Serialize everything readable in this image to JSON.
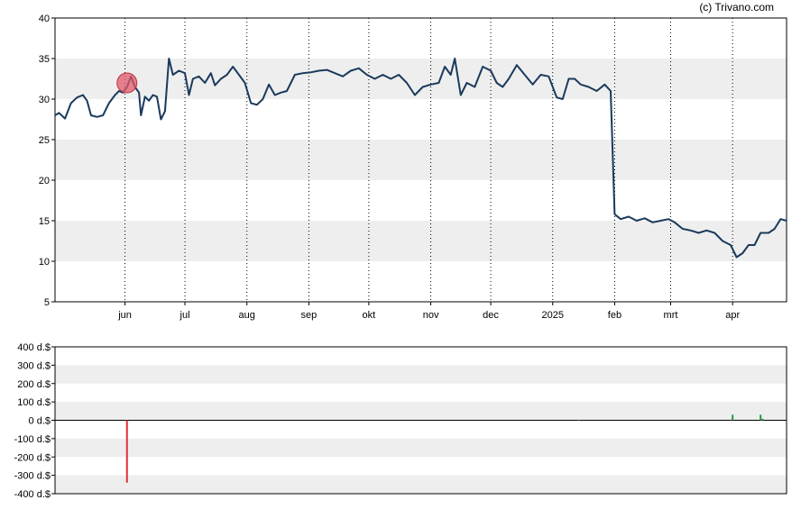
{
  "credit": "(c) Trivano.com",
  "chart_data": [
    {
      "type": "line",
      "title": "",
      "xlabel": "",
      "ylabel": "",
      "ylim": [
        5,
        40
      ],
      "y_ticks": [
        5,
        10,
        15,
        20,
        25,
        30,
        35,
        40
      ],
      "banding": "alternating light gray horizontal bands",
      "grid": "dotted vertical lines at month starts",
      "months": [
        {
          "label": "jun",
          "date": "2024-06-01"
        },
        {
          "label": "jul",
          "date": "2024-07-01"
        },
        {
          "label": "aug",
          "date": "2024-08-01"
        },
        {
          "label": "sep",
          "date": "2024-09-01"
        },
        {
          "label": "okt",
          "date": "2024-10-01"
        },
        {
          "label": "nov",
          "date": "2024-11-01"
        },
        {
          "label": "dec",
          "date": "2024-12-01"
        },
        {
          "label": "2025",
          "date": "2025-01-01"
        },
        {
          "label": "feb",
          "date": "2025-02-01"
        },
        {
          "label": "mrt",
          "date": "2025-03-01"
        },
        {
          "label": "apr",
          "date": "2025-04-01"
        }
      ],
      "x_range": [
        "2024-04-27",
        "2025-04-28"
      ],
      "line_color": "#1a3a5c",
      "series": [
        {
          "points": [
            [
              "2024-04-27",
              28.0
            ],
            [
              "2024-04-29",
              28.3
            ],
            [
              "2024-05-02",
              27.6
            ],
            [
              "2024-05-05",
              29.5
            ],
            [
              "2024-05-08",
              30.2
            ],
            [
              "2024-05-11",
              30.5
            ],
            [
              "2024-05-13",
              29.8
            ],
            [
              "2024-05-15",
              28.0
            ],
            [
              "2024-05-18",
              27.8
            ],
            [
              "2024-05-21",
              28.0
            ],
            [
              "2024-05-24",
              29.5
            ],
            [
              "2024-05-27",
              30.5
            ],
            [
              "2024-05-29",
              31.0
            ],
            [
              "2024-05-31",
              30.8
            ],
            [
              "2024-06-02",
              31.5
            ],
            [
              "2024-06-04",
              32.8
            ],
            [
              "2024-06-06",
              31.5
            ],
            [
              "2024-06-08",
              30.8
            ],
            [
              "2024-06-09",
              28.0
            ],
            [
              "2024-06-11",
              30.3
            ],
            [
              "2024-06-13",
              29.8
            ],
            [
              "2024-06-15",
              30.5
            ],
            [
              "2024-06-17",
              30.3
            ],
            [
              "2024-06-19",
              27.5
            ],
            [
              "2024-06-21",
              28.5
            ],
            [
              "2024-06-23",
              35.0
            ],
            [
              "2024-06-25",
              33.0
            ],
            [
              "2024-06-28",
              33.5
            ],
            [
              "2024-07-01",
              33.2
            ],
            [
              "2024-07-03",
              30.5
            ],
            [
              "2024-07-05",
              32.5
            ],
            [
              "2024-07-08",
              32.8
            ],
            [
              "2024-07-11",
              32.0
            ],
            [
              "2024-07-14",
              33.2
            ],
            [
              "2024-07-16",
              31.7
            ],
            [
              "2024-07-19",
              32.5
            ],
            [
              "2024-07-22",
              33.0
            ],
            [
              "2024-07-25",
              34.0
            ],
            [
              "2024-07-28",
              33.0
            ],
            [
              "2024-07-31",
              32.0
            ],
            [
              "2024-08-03",
              29.5
            ],
            [
              "2024-08-06",
              29.3
            ],
            [
              "2024-08-09",
              30.0
            ],
            [
              "2024-08-12",
              31.8
            ],
            [
              "2024-08-15",
              30.5
            ],
            [
              "2024-08-18",
              30.8
            ],
            [
              "2024-08-21",
              31.0
            ],
            [
              "2024-08-25",
              33.0
            ],
            [
              "2024-08-29",
              33.2
            ],
            [
              "2024-09-02",
              33.3
            ],
            [
              "2024-09-06",
              33.5
            ],
            [
              "2024-09-10",
              33.6
            ],
            [
              "2024-09-14",
              33.2
            ],
            [
              "2024-09-18",
              32.8
            ],
            [
              "2024-09-22",
              33.5
            ],
            [
              "2024-09-26",
              33.8
            ],
            [
              "2024-09-30",
              33.0
            ],
            [
              "2024-10-04",
              32.5
            ],
            [
              "2024-10-08",
              33.0
            ],
            [
              "2024-10-12",
              32.5
            ],
            [
              "2024-10-16",
              33.0
            ],
            [
              "2024-10-20",
              32.0
            ],
            [
              "2024-10-24",
              30.5
            ],
            [
              "2024-10-28",
              31.5
            ],
            [
              "2024-11-01",
              31.8
            ],
            [
              "2024-11-05",
              32.0
            ],
            [
              "2024-11-08",
              34.0
            ],
            [
              "2024-11-11",
              33.0
            ],
            [
              "2024-11-13",
              35.0
            ],
            [
              "2024-11-16",
              30.5
            ],
            [
              "2024-11-19",
              32.0
            ],
            [
              "2024-11-23",
              31.5
            ],
            [
              "2024-11-27",
              34.0
            ],
            [
              "2024-12-01",
              33.5
            ],
            [
              "2024-12-04",
              32.0
            ],
            [
              "2024-12-07",
              31.5
            ],
            [
              "2024-12-10",
              32.5
            ],
            [
              "2024-12-14",
              34.2
            ],
            [
              "2024-12-18",
              33.0
            ],
            [
              "2024-12-22",
              31.8
            ],
            [
              "2024-12-26",
              33.0
            ],
            [
              "2024-12-30",
              32.8
            ],
            [
              "2025-01-03",
              30.2
            ],
            [
              "2025-01-06",
              30.0
            ],
            [
              "2025-01-09",
              32.5
            ],
            [
              "2025-01-12",
              32.5
            ],
            [
              "2025-01-15",
              31.8
            ],
            [
              "2025-01-19",
              31.5
            ],
            [
              "2025-01-23",
              31.0
            ],
            [
              "2025-01-27",
              31.8
            ],
            [
              "2025-01-30",
              31.0
            ],
            [
              "2025-02-01",
              15.8
            ],
            [
              "2025-02-04",
              15.2
            ],
            [
              "2025-02-08",
              15.5
            ],
            [
              "2025-02-12",
              15.0
            ],
            [
              "2025-02-16",
              15.3
            ],
            [
              "2025-02-20",
              14.8
            ],
            [
              "2025-02-24",
              15.0
            ],
            [
              "2025-02-28",
              15.2
            ],
            [
              "2025-03-03",
              14.8
            ],
            [
              "2025-03-07",
              14.0
            ],
            [
              "2025-03-11",
              13.8
            ],
            [
              "2025-03-15",
              13.5
            ],
            [
              "2025-03-19",
              13.8
            ],
            [
              "2025-03-23",
              13.5
            ],
            [
              "2025-03-27",
              12.5
            ],
            [
              "2025-03-31",
              12.0
            ],
            [
              "2025-04-03",
              10.5
            ],
            [
              "2025-04-06",
              11.0
            ],
            [
              "2025-04-09",
              12.0
            ],
            [
              "2025-04-12",
              12.0
            ],
            [
              "2025-04-15",
              13.5
            ],
            [
              "2025-04-19",
              13.5
            ],
            [
              "2025-04-22",
              14.0
            ],
            [
              "2025-04-25",
              15.2
            ],
            [
              "2025-04-28",
              15.0
            ]
          ]
        }
      ],
      "marker": {
        "date": "2024-06-02",
        "value": 32.0,
        "color": "#e05a6a"
      }
    },
    {
      "type": "bar",
      "title": "",
      "xlabel": "",
      "ylabel": "",
      "ylim": [
        -400,
        400
      ],
      "y_ticks": [
        {
          "value": 400,
          "label": "400 d.$"
        },
        {
          "value": 300,
          "label": "300 d.$"
        },
        {
          "value": 200,
          "label": "200 d.$"
        },
        {
          "value": 100,
          "label": "100 d.$"
        },
        {
          "value": 0,
          "label": "0 d.$"
        },
        {
          "value": -100,
          "label": "-100 d.$"
        },
        {
          "value": -200,
          "label": "-200 d.$"
        },
        {
          "value": -300,
          "label": "-300 d.$"
        },
        {
          "value": -400,
          "label": "-400 d.$"
        }
      ],
      "banding": "alternating light gray horizontal bands",
      "bars": [
        {
          "date": "2024-06-02",
          "value": -340,
          "color": "#e0303a"
        },
        {
          "date": "2025-01-14",
          "value": 3,
          "color": "#2a9a3a"
        },
        {
          "date": "2025-04-01",
          "value": 30,
          "color": "#2a9a3a"
        },
        {
          "date": "2025-04-15",
          "value": 30,
          "color": "#2a9a3a"
        },
        {
          "date": "2025-04-16",
          "value": 8,
          "color": "#2a9a3a"
        }
      ]
    }
  ]
}
